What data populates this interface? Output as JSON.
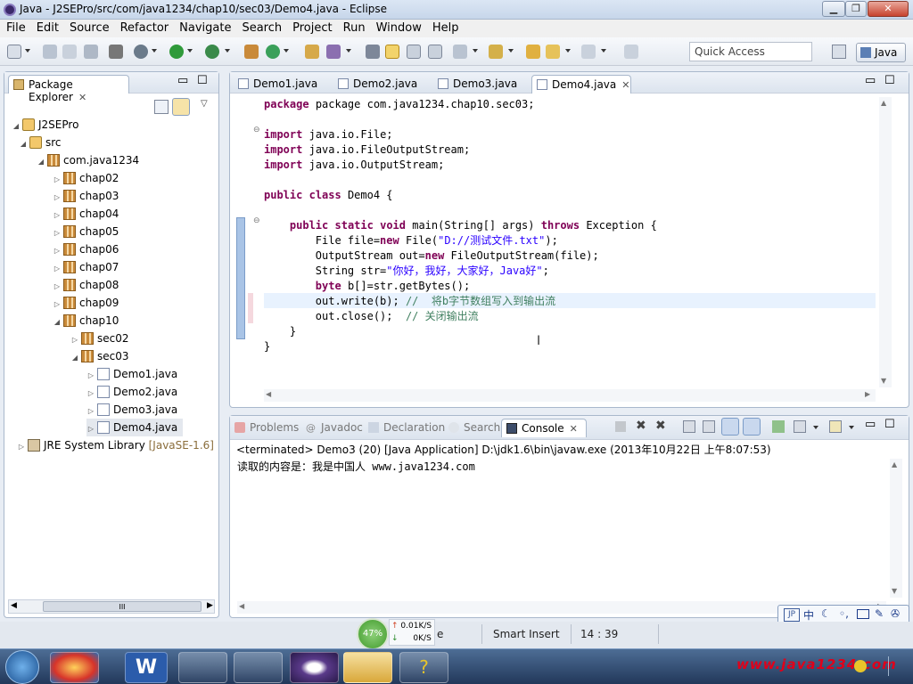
{
  "window": {
    "title": "Java - J2SEPro/src/com/java1234/chap10/sec03/Demo4.java - Eclipse"
  },
  "menu": [
    "File",
    "Edit",
    "Source",
    "Refactor",
    "Navigate",
    "Search",
    "Project",
    "Run",
    "Window",
    "Help"
  ],
  "toolbar": {
    "quick_access_placeholder": "Quick Access",
    "perspective": "Java"
  },
  "package_explorer": {
    "title": "Package Explorer",
    "items": [
      {
        "label": "J2SEPro"
      },
      {
        "label": "src"
      },
      {
        "label": "com.java1234"
      },
      {
        "label": "chap02"
      },
      {
        "label": "chap03"
      },
      {
        "label": "chap04"
      },
      {
        "label": "chap05"
      },
      {
        "label": "chap06"
      },
      {
        "label": "chap07"
      },
      {
        "label": "chap08"
      },
      {
        "label": "chap09"
      },
      {
        "label": "chap10"
      },
      {
        "label": "sec02"
      },
      {
        "label": "sec03"
      },
      {
        "label": "Demo1.java"
      },
      {
        "label": "Demo2.java"
      },
      {
        "label": "Demo3.java"
      },
      {
        "label": "Demo4.java"
      },
      {
        "label": "JRE System Library",
        "suffix": "[JavaSE-1.6]"
      }
    ],
    "scroll_glyph": "III"
  },
  "editor": {
    "tabs": [
      "Demo1.java",
      "Demo2.java",
      "Demo3.java",
      "Demo4.java"
    ],
    "active_tab": "Demo4.java",
    "code": {
      "l1": "package com.java1234.chap10.sec03;",
      "l3": "java.io.File;",
      "l4": "java.io.FileOutputStream;",
      "l5": "java.io.OutputStream;",
      "l7": "Demo4 {",
      "l9a": "main(String[] args) ",
      "l9b": "Exception {",
      "l10a": "File file=",
      "l10b": "File(",
      "l10s": "\"D://测试文件.txt\"",
      "l10c": ");",
      "l11a": "OutputStream out=",
      "l11b": "FileOutputStream(file);",
      "l12a": "String str=",
      "l12s": "\"你好，我好，大家好，Java好\"",
      "l12c": ";",
      "l13": "b[]=str.getBytes();",
      "l14a": "out.write(b); ",
      "l14c": "//  将b字节数组写入到输出流",
      "l15a": "out.close();  ",
      "l15c": "// 关闭输出流",
      "l16": "}",
      "l17": "}"
    },
    "keywords": {
      "package": "package",
      "import": "import",
      "public": "public",
      "class": "class",
      "static": "static",
      "void": "void",
      "throws": "throws",
      "new": "new",
      "byte": "byte"
    }
  },
  "bottom_tabs": [
    "Problems",
    "Javadoc",
    "Declaration",
    "Search",
    "Console"
  ],
  "console": {
    "status": "<terminated> Demo3 (20) [Java Application] D:\\jdk1.6\\bin\\javaw.exe (2013年10月22日 上午8:07:53)",
    "output": "读取的内容是：我是中国人 www.java1234.com"
  },
  "status_bar": {
    "network_percent": "47%",
    "upload": "0.01K/S",
    "download": "0K/S",
    "writable": "e",
    "insert_mode": "Smart Insert",
    "position": "14 : 39"
  },
  "ime_bar": {
    "label_jp": "JP",
    "label_zh": "中"
  },
  "watermark": "www.java1234.com",
  "colors": {
    "keyword": "#7f0055",
    "string": "#2a00ff",
    "comment": "#3f7f5f",
    "watermark": "#e0001a"
  }
}
